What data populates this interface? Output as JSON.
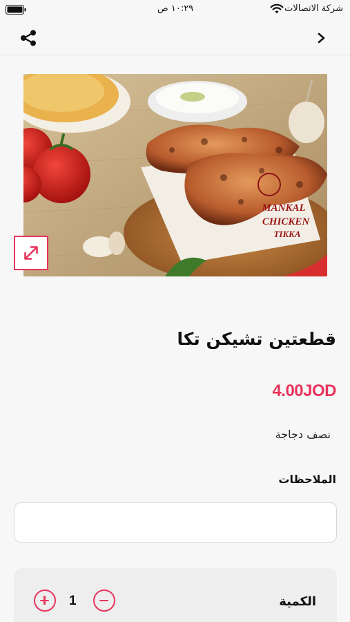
{
  "status_bar": {
    "carrier": "شركة الاتصالات",
    "time": "١٠:٢٩ ص"
  },
  "nav": {
    "share_icon": "share-icon",
    "back_icon": "chevron-right-icon"
  },
  "product": {
    "image_alt": "قطعتين تشيكن تكا",
    "title": "قطعتين تشيكن تكا",
    "price": "4.00JOD",
    "description": "نصف دجاجة",
    "watermark_line1": "MANKAL",
    "watermark_line2": "CHICKEN",
    "watermark_line3": "TIKKA"
  },
  "notes": {
    "label": "الملاحظات",
    "value": "",
    "placeholder": ""
  },
  "quantity": {
    "label": "الكمية",
    "value": "1"
  },
  "colors": {
    "accent": "#e8345c",
    "background": "#f7f7f7"
  }
}
